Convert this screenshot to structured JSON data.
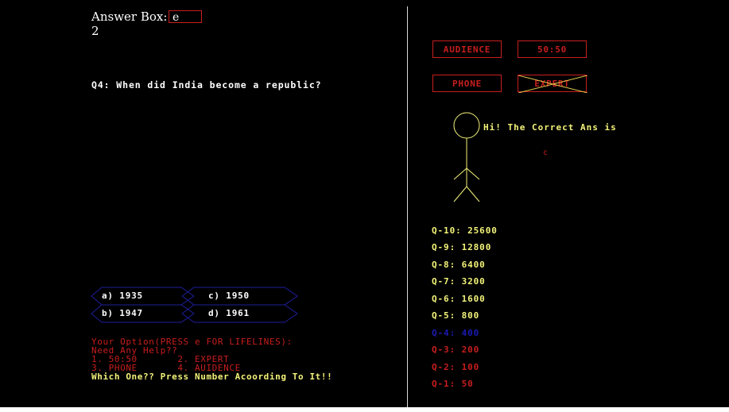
{
  "answer_box": {
    "label": "Answer Box:",
    "value": "e"
  },
  "typed_value": "2",
  "question": "Q4: When did India become a republic?",
  "options": [
    {
      "label": "a) 1935"
    },
    {
      "label": "c) 1950"
    },
    {
      "label": "b) 1947"
    },
    {
      "label": "d) 1961"
    }
  ],
  "prompt": {
    "your_option": "Your Option(PRESS e FOR LIFELINES):",
    "need_help": "Need Any Help??",
    "line_1": "1. 50:50       2. EXPERT",
    "line_2": "3. PHONE       4. AUIDENCE",
    "which_one": "Which One?? Press Number Acoording To It!!"
  },
  "lifelines": {
    "audience": "AUDIENCE",
    "fifty_fifty": "50:50",
    "phone": "PHONE",
    "expert": "EXPERT"
  },
  "expert_speech": "Hi! The Correct Ans is",
  "expert_answer": "c",
  "prize_ladder": [
    {
      "label": "Q-10: 25600",
      "state": "upcoming"
    },
    {
      "label": "Q-9: 12800",
      "state": "upcoming"
    },
    {
      "label": "Q-8: 6400",
      "state": "upcoming"
    },
    {
      "label": "Q-7: 3200",
      "state": "upcoming"
    },
    {
      "label": "Q-6: 1600",
      "state": "upcoming"
    },
    {
      "label": "Q-5: 800",
      "state": "upcoming"
    },
    {
      "label": "Q-4: 400",
      "state": "current"
    },
    {
      "label": "Q-3: 200",
      "state": "won"
    },
    {
      "label": "Q-2: 100",
      "state": "won"
    },
    {
      "label": "Q-1: 50",
      "state": "won"
    }
  ],
  "colors": {
    "background": "#000000",
    "upcoming": "#f3f37a",
    "current": "#1a1ab4",
    "won": "#c81e1e",
    "option_border": "#1e1e9c",
    "lifeline_border": "#c81e1e",
    "used_cross": "#e8c84a"
  }
}
